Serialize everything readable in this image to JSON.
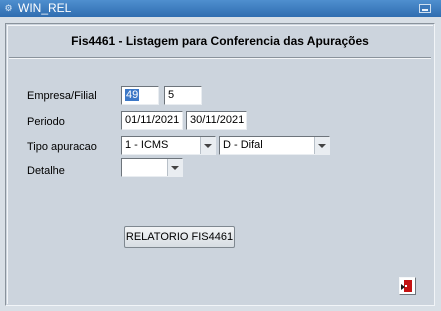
{
  "window": {
    "title": "WIN_REL"
  },
  "form": {
    "heading": "Fis4461 - Listagem  para Conferencia das Apurações",
    "labels": {
      "empresa_filial": "Empresa/Filial",
      "periodo": "Periodo",
      "tipo_apuracao": "Tipo apuracao",
      "detalhe": "Detalhe"
    },
    "values": {
      "empresa": "49",
      "filial": "5",
      "periodo_inicio": "01/11/2021",
      "periodo_fim": "30/11/2021",
      "tipo_apuracao_1": "1 - ICMS",
      "tipo_apuracao_2": "D - Difal",
      "detalhe": ""
    },
    "report_button_label": "RELATORIO FIS4461"
  },
  "icons": {
    "window_icon": "app-icon",
    "exit_icon": "exit-door-icon"
  }
}
